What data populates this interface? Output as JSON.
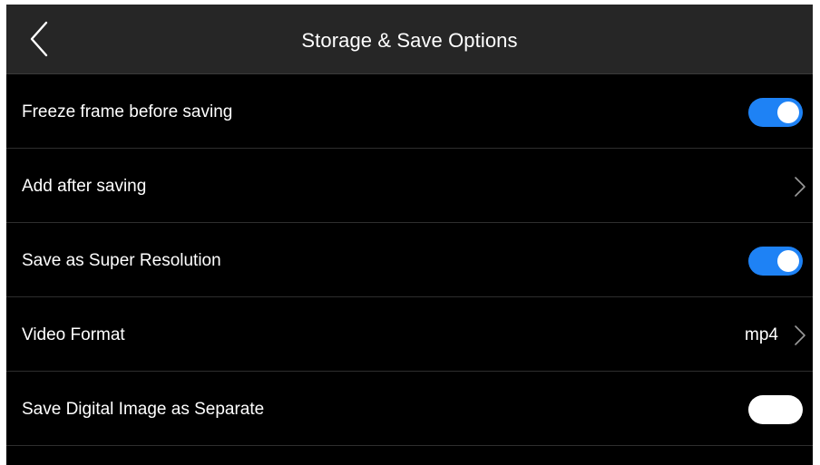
{
  "header": {
    "title": "Storage & Save Options",
    "back_icon": "chevron-left-icon"
  },
  "settings": [
    {
      "label": "Freeze frame before saving",
      "control": "toggle",
      "state": "on"
    },
    {
      "label": "Add after saving",
      "control": "chevron"
    },
    {
      "label": "Save as Super Resolution",
      "control": "toggle",
      "state": "on"
    },
    {
      "label": "Video Format",
      "control": "value-chevron",
      "value": "mp4"
    },
    {
      "label": "Save Digital Image as Separate",
      "control": "toggle",
      "state": "off"
    }
  ],
  "colors": {
    "background": "#000000",
    "header": "#262626",
    "accent": "#1e82f5",
    "divider": "#2e2e2e",
    "text": "#ffffff"
  }
}
